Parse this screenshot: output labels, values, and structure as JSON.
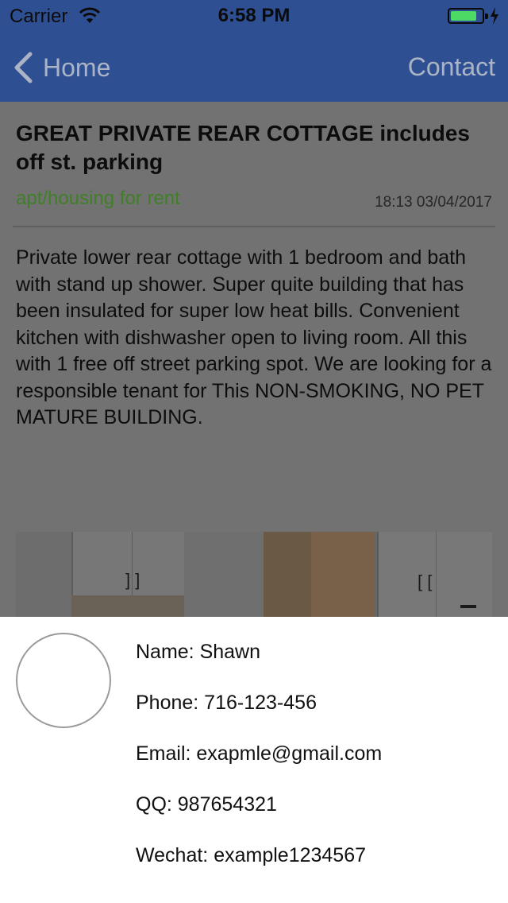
{
  "status_bar": {
    "carrier": "Carrier",
    "time": "6:58 PM",
    "battery_color": "#4cd964"
  },
  "nav_bar": {
    "back_label": "Home",
    "back_icon": "chevron-left-icon",
    "right_label": "Contact",
    "background_color": "#2f4f93"
  },
  "listing": {
    "title": "GREAT PRIVATE REAR COTTAGE includes off st. parking",
    "category": "apt/housing for rent",
    "category_color": "#3f7f26",
    "timestamp": "18:13 03/04/2017",
    "description": "Private lower rear cottage with 1 bedroom and bath with stand up shower. Super quite building that has been insulated for super low heat bills. Convenient kitchen with dishwasher open to living room. All this with 1 free off street parking spot. We are looking for a responsible tenant for This NON-SMOKING, NO PET MATURE BUILDING."
  },
  "contact": {
    "name": "Name: Shawn",
    "phone": "Phone: 716-123-456",
    "email": "Email: exapmle@gmail.com",
    "qq": "QQ: 987654321",
    "wechat": "Wechat: example1234567"
  }
}
